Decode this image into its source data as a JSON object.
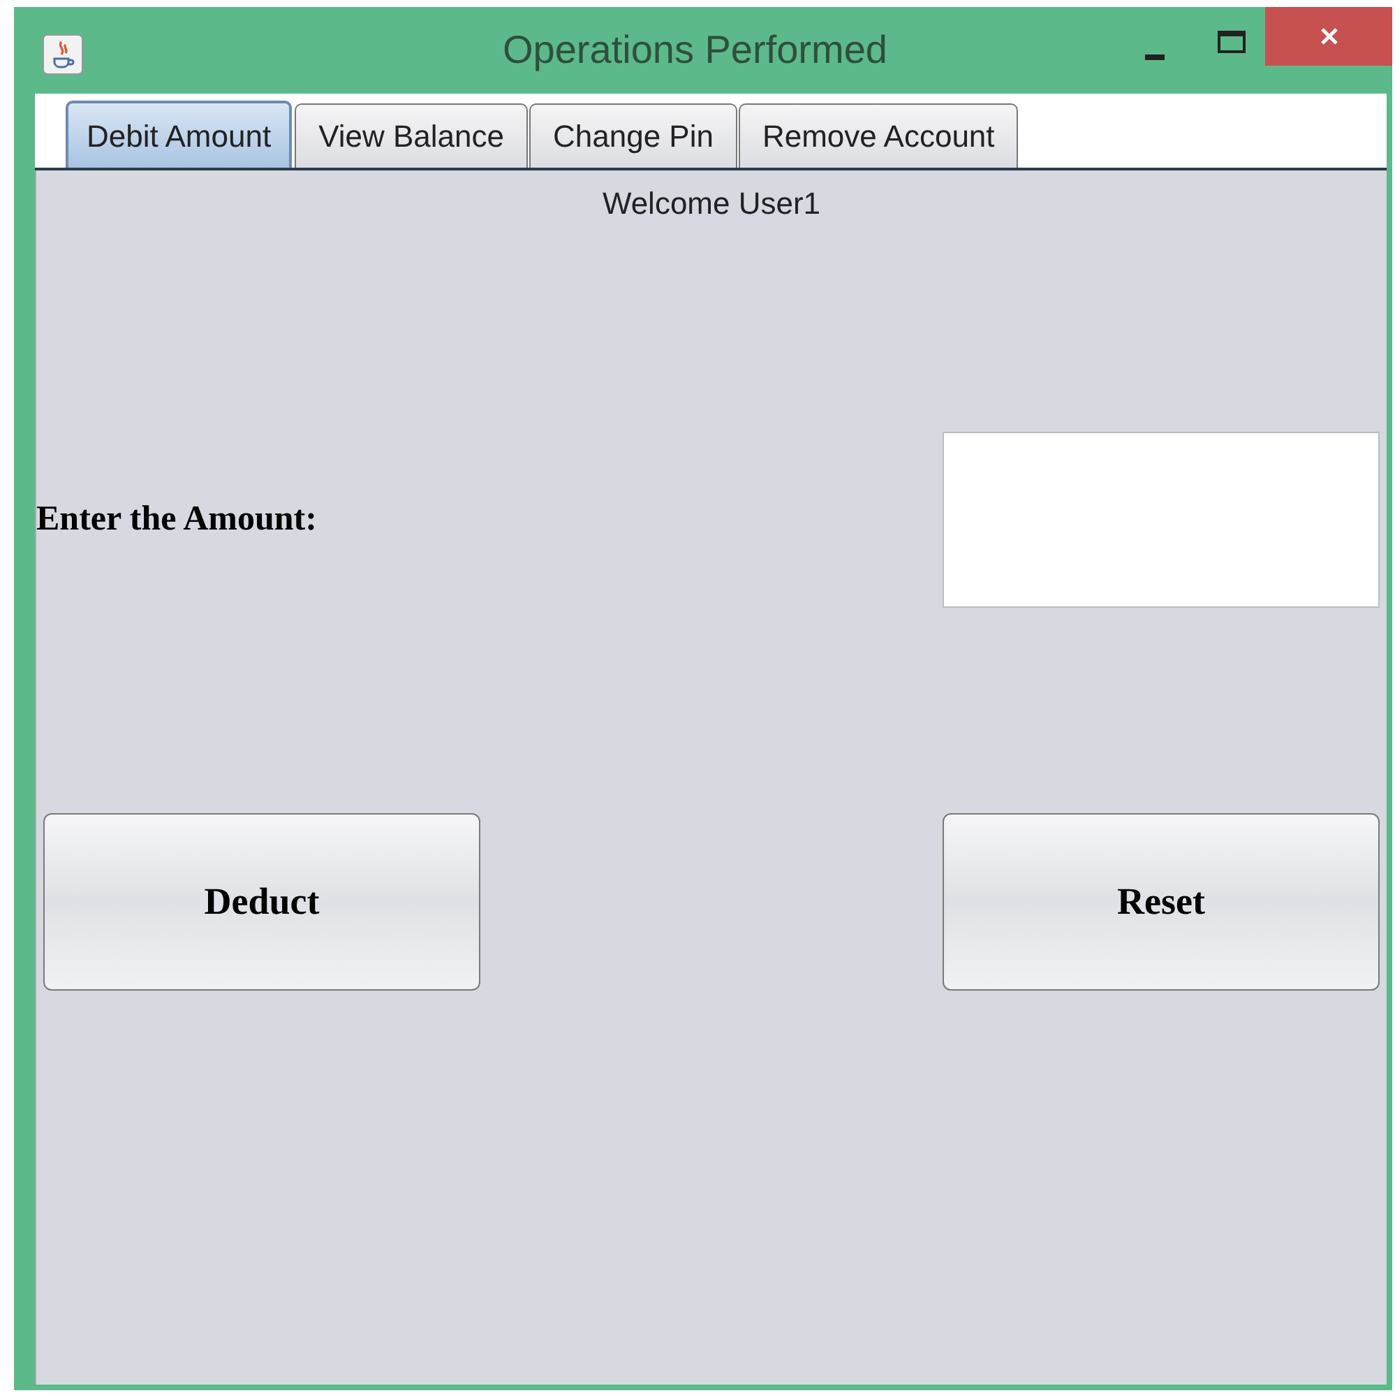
{
  "window": {
    "title": "Operations Performed"
  },
  "tabs": [
    {
      "label": "Debit Amount",
      "selected": true
    },
    {
      "label": "View Balance",
      "selected": false
    },
    {
      "label": "Change Pin",
      "selected": false
    },
    {
      "label": "Remove Account",
      "selected": false
    }
  ],
  "panel": {
    "welcome": "Welcome User1",
    "amount_label": "Enter the Amount:",
    "buttons": [
      "Deduct",
      "Reset"
    ]
  }
}
